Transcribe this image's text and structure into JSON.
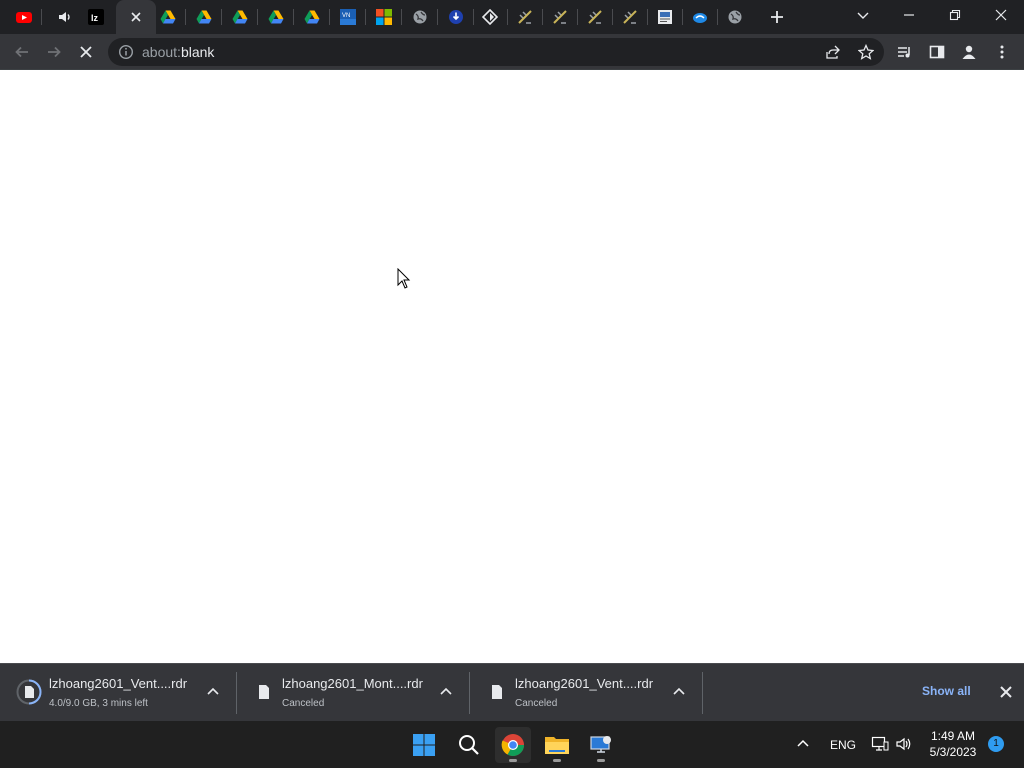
{
  "browser": {
    "tabs": [
      {
        "icon": "youtube-icon",
        "muted": false
      },
      {
        "icon": "speaker-icon",
        "muted": false
      },
      {
        "icon": "lz-logo-icon",
        "text": "lz"
      },
      {
        "icon": "close-icon",
        "active": true
      },
      {
        "icon": "google-drive-icon"
      },
      {
        "icon": "google-drive-icon"
      },
      {
        "icon": "google-drive-icon"
      },
      {
        "icon": "google-drive-icon"
      },
      {
        "icon": "google-drive-icon"
      },
      {
        "icon": "vn-site-icon"
      },
      {
        "icon": "microsoft-icon"
      },
      {
        "icon": "globe-icon"
      },
      {
        "icon": "download-circle-icon"
      },
      {
        "icon": "diamond-icon"
      },
      {
        "icon": "pen-site-icon"
      },
      {
        "icon": "pen-site-icon"
      },
      {
        "icon": "pen-site-icon"
      },
      {
        "icon": "pen-site-icon"
      },
      {
        "icon": "document-site-icon"
      },
      {
        "icon": "blue-cloud-icon"
      },
      {
        "icon": "globe-icon"
      }
    ],
    "address": {
      "scheme": "about:",
      "host": "blank"
    }
  },
  "downloads": [
    {
      "name": "lzhoang2601_Vent....rdr",
      "status": "4.0/9.0 GB, 3 mins left",
      "in_progress": true
    },
    {
      "name": "lzhoang2601_Mont....rdr",
      "status": "Canceled",
      "in_progress": false
    },
    {
      "name": "lzhoang2601_Vent....rdr",
      "status": "Canceled",
      "in_progress": false
    }
  ],
  "shelf": {
    "show_all_label": "Show all"
  },
  "taskbar": {
    "apps": [
      "windows-start-icon",
      "search-icon",
      "chrome-icon",
      "file-explorer-icon",
      "remote-desktop-icon"
    ],
    "lang": "ENG",
    "time": "1:49 AM",
    "date": "5/3/2023",
    "notifications": "1"
  }
}
